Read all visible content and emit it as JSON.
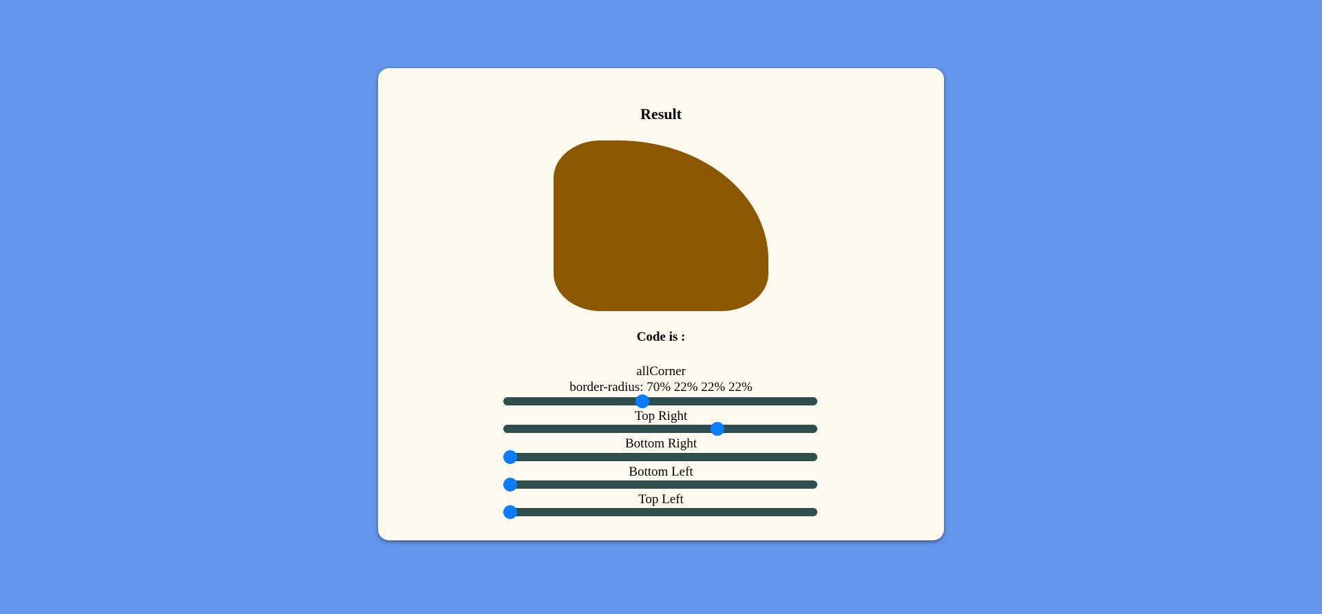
{
  "result_title": "Result",
  "shape_color": "#8b5700",
  "code_title": "Code is :",
  "code_label": "allCorner",
  "code_value": "border-radius: 70% 22% 22% 22%",
  "sliders": [
    {
      "label": "",
      "value": 44
    },
    {
      "label": "Top Right",
      "value": 69
    },
    {
      "label": "Bottom Right",
      "value": 0
    },
    {
      "label": "Bottom Left",
      "value": 0
    },
    {
      "label": "Top Left",
      "value": 0
    }
  ],
  "colors": {
    "background": "#6495ed",
    "card": "#fcf9ee",
    "track": "#2f4f4f",
    "thumb": "#0a7cff"
  }
}
